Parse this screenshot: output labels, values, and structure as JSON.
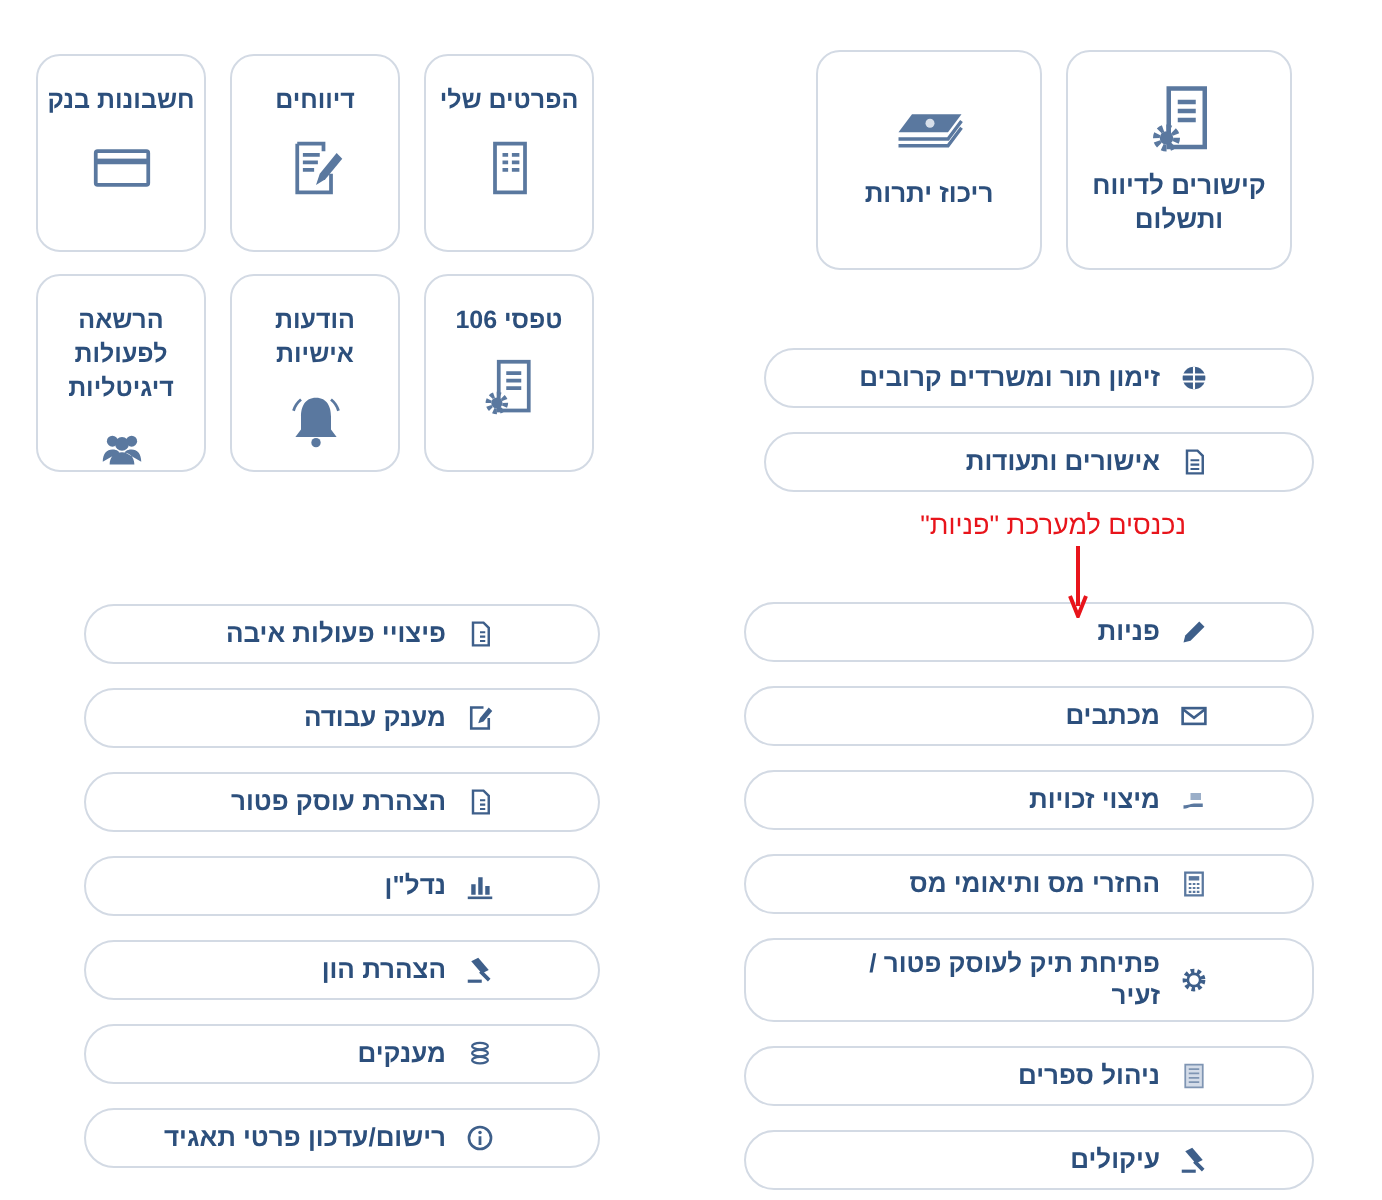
{
  "summary_tiles": [
    {
      "label": "קישורים לדיווח ותשלום"
    },
    {
      "label": "ריכוז יתרות"
    }
  ],
  "quick_links": [
    {
      "label": "זימון תור ומשרדים קרובים"
    },
    {
      "label": "אישורים ותעודות"
    }
  ],
  "annotation": {
    "text": "נכנסים למערכת \"פניות\""
  },
  "services_right": [
    {
      "label": "פניות"
    },
    {
      "label": "מכתבים"
    },
    {
      "label": "מיצוי זכויות"
    },
    {
      "label": "החזרי מס ותיאומי מס"
    },
    {
      "label": "פתיחת תיק לעוסק פטור / זעיר"
    },
    {
      "label": "ניהול ספרים"
    },
    {
      "label": "עיקולים"
    }
  ],
  "account_tiles": [
    {
      "label": "הפרטים שלי"
    },
    {
      "label": "דיווחים"
    },
    {
      "label": "חשבונות בנק"
    },
    {
      "label": "טפסי 106"
    },
    {
      "label": "הודעות אישיות"
    },
    {
      "label": "הרשאה לפעולות דיגיטליות"
    }
  ],
  "services_left": [
    {
      "label": "פיצויי פעולות איבה"
    },
    {
      "label": "מענק עבודה"
    },
    {
      "label": "הצהרת עוסק פטור"
    },
    {
      "label": "נדל\"ן"
    },
    {
      "label": "הצהרת הון"
    },
    {
      "label": "מענקים"
    },
    {
      "label": "רישום/עדכון פרטי תאגיד"
    }
  ]
}
